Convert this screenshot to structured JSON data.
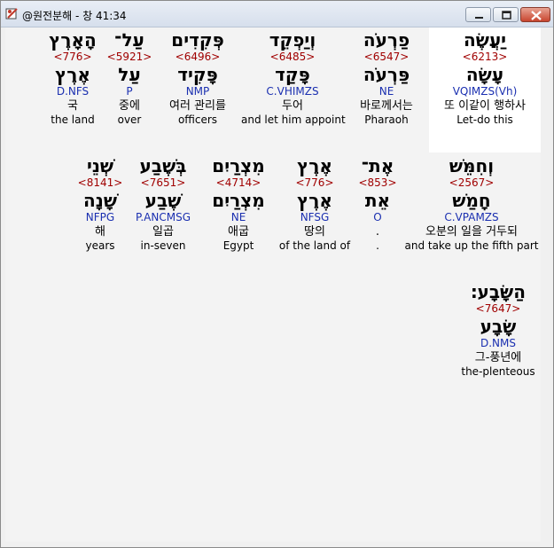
{
  "window": {
    "title": "@원전분해 - 창 41:34"
  },
  "rows": [
    [
      {
        "heb": "יַעֲשֶׂה",
        "num": "<6213>",
        "lemma": "עָשָׂה",
        "morph": "VQIMZS(Vh)",
        "kor": "또 이같이 행하사",
        "eng": "Let-do this"
      },
      {
        "heb": "פַרְעֹה",
        "num": "<6547>",
        "lemma": "פַּרְעֹה",
        "morph": "NE",
        "kor": "바로께서는",
        "eng": "Pharaoh"
      },
      {
        "heb": "וְיַפְקֵד",
        "num": "<6485>",
        "lemma": "פָּקַד",
        "morph": "C.VHIMZS",
        "kor": "두어",
        "eng": "and let him appoint"
      },
      {
        "heb": "פְּקִדִים",
        "num": "<6496>",
        "lemma": "פָּקִיד",
        "morph": "NMP",
        "kor": "여러 관리를",
        "eng": "officers"
      },
      {
        "heb": "עַל־",
        "num": "<5921>",
        "lemma": "עַל",
        "morph": "P",
        "kor": "중에",
        "eng": "over"
      },
      {
        "heb": "הָאָרֶץ",
        "num": "<776>",
        "lemma": "אֶרֶץ",
        "morph": "D.NFS",
        "kor": "국",
        "eng": "the land"
      }
    ],
    [
      {
        "heb": "וְחִמֵּשׁ",
        "num": "<2567>",
        "lemma": "חָמַשׁ",
        "morph": "C.VPAMZS",
        "kor": "오분의 일을 거두되",
        "eng": "and take up the fifth part"
      },
      {
        "heb": "אֶת־",
        "num": "<853>",
        "lemma": "אֵת",
        "morph": "O",
        "kor": ".",
        "eng": "."
      },
      {
        "heb": "אֶרֶץ",
        "num": "<776>",
        "lemma": "אֶרֶץ",
        "morph": "NFSG",
        "kor": "땅의",
        "eng": "of the land of"
      },
      {
        "heb": "מִצְרַיִם",
        "num": "<4714>",
        "lemma": "מִצְרַיִם",
        "morph": "NE",
        "kor": "애굽",
        "eng": "Egypt"
      },
      {
        "heb": "בְּשֶׁבַע",
        "num": "<7651>",
        "lemma": "שֶׁבַע",
        "morph": "P.ANCMSG",
        "kor": "일곱",
        "eng": "in-seven"
      },
      {
        "heb": "שְׁנֵי",
        "num": "<8141>",
        "lemma": "שָׁנָה",
        "morph": "NFPG",
        "kor": "해",
        "eng": "years"
      }
    ],
    [
      {
        "heb": "הַשָּׂבָע׃",
        "num": "<7647>",
        "lemma": "שָׂבָע",
        "morph": "D.NMS",
        "kor": "그-풍년에",
        "eng": "the-plenteous"
      }
    ]
  ]
}
